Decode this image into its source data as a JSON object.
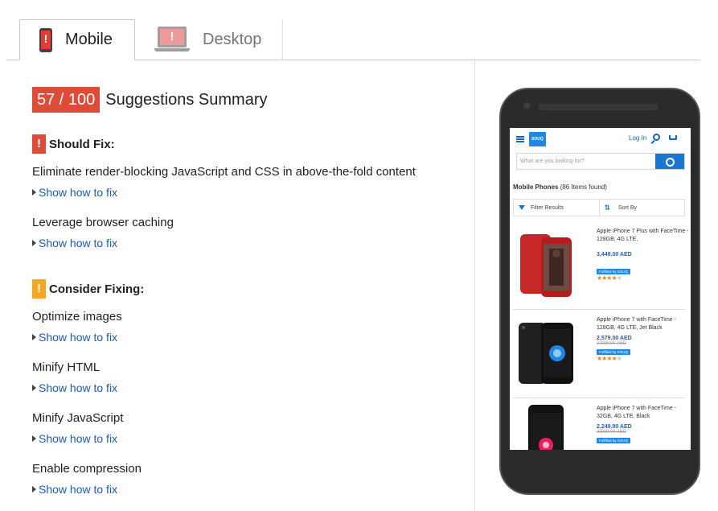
{
  "tabs": [
    {
      "label": "Mobile",
      "active": true,
      "icon": "mobile-warning-icon"
    },
    {
      "label": "Desktop",
      "active": false,
      "icon": "desktop-warning-icon"
    }
  ],
  "summary": {
    "score": "57 / 100",
    "title": "Suggestions Summary",
    "score_color": "#dd4b39"
  },
  "should_fix": {
    "heading": "Should Fix:",
    "badge": "!",
    "color": "#dd4b39",
    "rules": [
      {
        "title": "Eliminate render-blocking JavaScript and CSS in above-the-fold content",
        "link": "Show how to fix"
      },
      {
        "title": "Leverage browser caching",
        "link": "Show how to fix"
      }
    ]
  },
  "consider_fixing": {
    "heading": "Consider Fixing:",
    "badge": "!",
    "color": "#f5a623",
    "rules": [
      {
        "title": "Optimize images",
        "link": "Show how to fix"
      },
      {
        "title": "Minify HTML",
        "link": "Show how to fix"
      },
      {
        "title": "Minify JavaScript",
        "link": "Show how to fix"
      },
      {
        "title": "Enable compression",
        "link": "Show how to fix"
      }
    ]
  },
  "preview": {
    "logo": "SOUQ",
    "login": "Log In",
    "search_placeholder": "What are you looking for?",
    "title_bold": "Mobile Phones",
    "title_count": "(86 Items found)",
    "filter_label": "Filter Results",
    "sort_label": "Sort By",
    "products": [
      {
        "name": "Apple iPhone 7 Plus with FaceTime - 128GB, 4G LTE,",
        "price": "3,449.00 AED",
        "old_price": "",
        "fulfilled": "Fulfilled by SOUQ",
        "rating": 4
      },
      {
        "name": "Apple iPhone 7 with FaceTime - 128GB, 4G LTE, Jet Black",
        "price": "2,579.00 AED",
        "old_price": "2,999.00 AED",
        "fulfilled": "Fulfilled by SOUQ",
        "rating": 4
      },
      {
        "name": "Apple iPhone 7 with FaceTime - 32GB, 4G LTE, Black",
        "price": "2,249.00 AED",
        "old_price": "2,599.00 AED",
        "fulfilled": "Fulfilled by SOUQ",
        "rating": 0
      }
    ]
  }
}
